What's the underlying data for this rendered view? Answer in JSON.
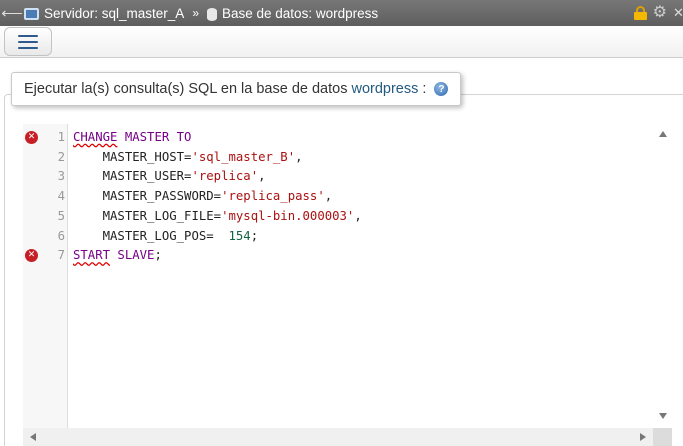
{
  "breadcrumb": {
    "server_label": "Servidor: sql_master_A",
    "separator": "»",
    "database_label": "Base de datos: wordpress"
  },
  "icons": {
    "back": "arrow-left-icon",
    "server": "server-icon",
    "database": "database-icon",
    "lock": "lock-icon",
    "settings": "gear-icon",
    "close": "close-icon",
    "menu": "hamburger-icon",
    "help": "help-icon",
    "error": "error-marker-icon"
  },
  "query_box": {
    "legend_text": "Ejecutar la(s) consulta(s) SQL en la base de datos",
    "database_name": "wordpress",
    "legend_suffix": ":",
    "help_glyph": "?"
  },
  "editor": {
    "lines": [
      {
        "number": "1",
        "has_error": true,
        "tokens": [
          {
            "text": "CHANGE",
            "type": "kw error"
          },
          {
            "text": " MASTER TO",
            "type": "kw"
          }
        ]
      },
      {
        "number": "2",
        "has_error": false,
        "tokens": [
          {
            "text": "    MASTER_HOST=",
            "type": "plain"
          },
          {
            "text": "'sql_master_B'",
            "type": "str"
          },
          {
            "text": ",",
            "type": "plain"
          }
        ]
      },
      {
        "number": "3",
        "has_error": false,
        "tokens": [
          {
            "text": "    MASTER_USER=",
            "type": "plain"
          },
          {
            "text": "'replica'",
            "type": "str"
          },
          {
            "text": ",",
            "type": "plain"
          }
        ]
      },
      {
        "number": "4",
        "has_error": false,
        "tokens": [
          {
            "text": "    MASTER_PASSWORD=",
            "type": "plain"
          },
          {
            "text": "'replica_pass'",
            "type": "str"
          },
          {
            "text": ",",
            "type": "plain"
          }
        ]
      },
      {
        "number": "5",
        "has_error": false,
        "tokens": [
          {
            "text": "    MASTER_LOG_FILE=",
            "type": "plain"
          },
          {
            "text": "'mysql-bin.000003'",
            "type": "str"
          },
          {
            "text": ",",
            "type": "plain"
          }
        ]
      },
      {
        "number": "6",
        "has_error": false,
        "tokens": [
          {
            "text": "    MASTER_LOG_POS=  ",
            "type": "plain"
          },
          {
            "text": "154",
            "type": "num"
          },
          {
            "text": ";",
            "type": "plain"
          }
        ]
      },
      {
        "number": "7",
        "has_error": true,
        "tokens": [
          {
            "text": "START",
            "type": "kw error"
          },
          {
            "text": " SLAVE",
            "type": "kw"
          },
          {
            "text": ";",
            "type": "plain"
          }
        ]
      }
    ]
  },
  "colors": {
    "topbar": "#686868",
    "link": "#235a81",
    "keyword": "#770088",
    "string": "#aa1111",
    "number": "#116644",
    "error": "#c62026"
  }
}
